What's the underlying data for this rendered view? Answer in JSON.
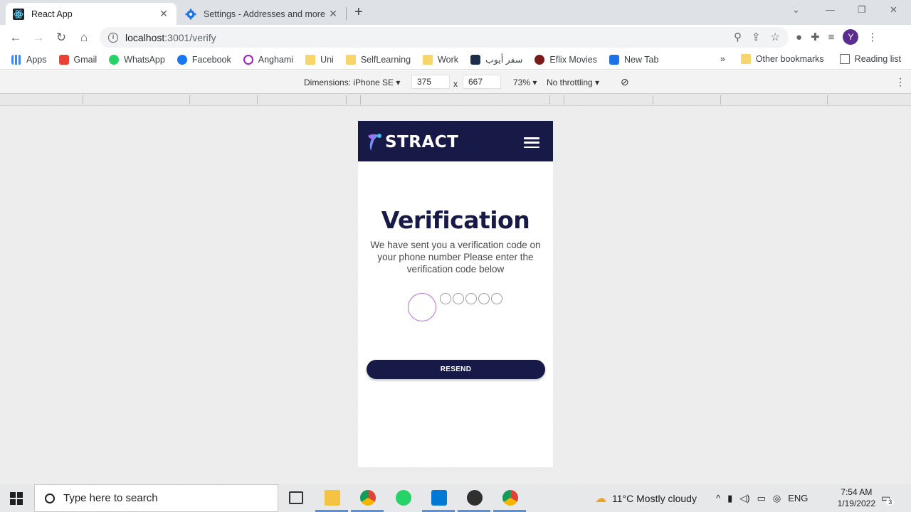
{
  "browser": {
    "tabs": [
      {
        "title": "React App",
        "icon": "react-icon",
        "active": true
      },
      {
        "title": "Settings - Addresses and more",
        "icon": "gear-icon",
        "active": false
      }
    ],
    "url_host": "localhost",
    "url_path": ":3001/verify",
    "avatar_letter": "Y",
    "bookmarks": [
      "Apps",
      "Gmail",
      "WhatsApp",
      "Facebook",
      "Anghami",
      "Uni",
      "SelfLearning",
      "Work",
      "سفر أيوب",
      "Eflix Movies",
      "New Tab"
    ],
    "other_bookmarks": "Other bookmarks",
    "reading_list": "Reading list",
    "more_bookmarks": "»"
  },
  "devtools": {
    "dimensions": "Dimensions: iPhone SE",
    "width": "375",
    "times": "x",
    "height": "667",
    "zoom": "73%",
    "throttling": "No throttling"
  },
  "app": {
    "brand": "STRACT",
    "title": "Verification",
    "message": "We have sent you a verification code on your phone number Please enter the verification code below",
    "resend_label": "RESEND",
    "otp_count": 6
  },
  "taskbar": {
    "search_placeholder": "Type here to search",
    "weather": "11°C  Mostly cloudy",
    "language": "ENG",
    "time": "7:54 AM",
    "date": "1/19/2022",
    "notifications": "3"
  },
  "colors": {
    "brand_navy": "#171a46",
    "otp_active": "#b96fd7"
  }
}
